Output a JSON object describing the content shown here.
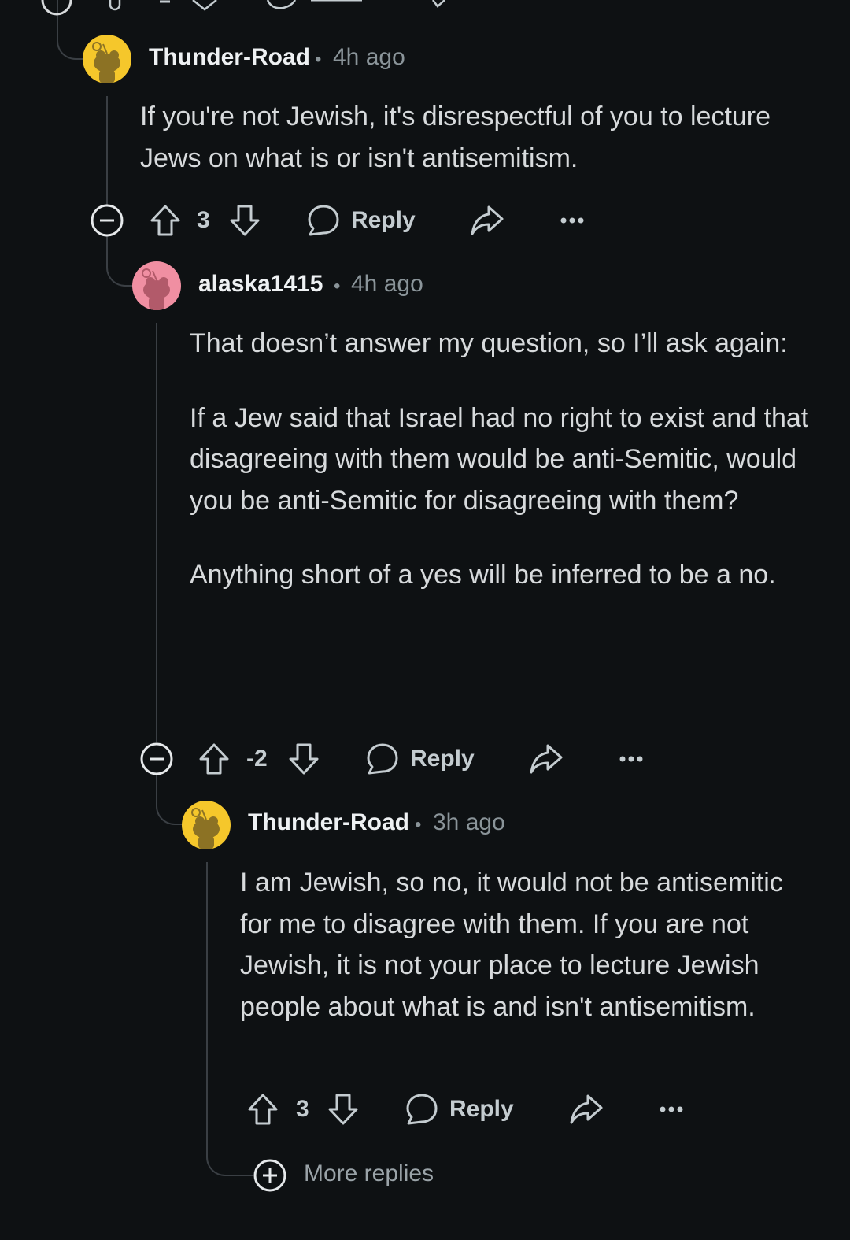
{
  "comments": [
    {
      "username": "Thunder-Road",
      "separator": "•",
      "time": "4h ago",
      "paragraphs": [
        "If you're not Jewish, it's disrespectful of you to lecture Jews on what is or isn't antisemitism."
      ],
      "votes": "3",
      "reply_label": "Reply",
      "avatar_color": "#f5c72b"
    },
    {
      "username": "alaska1415",
      "separator": "•",
      "time": "4h ago",
      "paragraphs": [
        "That doesn’t answer my question, so I’ll ask again:",
        "If a Jew said that Israel had no right to exist and that disagreeing with them would be anti-Semitic, would you be anti-Semitic for disagreeing with them?",
        "Anything short of a yes will be inferred to be a no."
      ],
      "votes": "-2",
      "reply_label": "Reply",
      "avatar_color": "#f08fa2"
    },
    {
      "username": "Thunder-Road",
      "separator": "•",
      "time": "3h ago",
      "paragraphs": [
        "I am Jewish, so no, it would not be antisemitic for me to disagree with them. If you are not Jewish, it is not your place to lecture Jewish people about what is and isn't antisemitism."
      ],
      "votes": "3",
      "reply_label": "Reply",
      "avatar_color": "#f5c72b"
    }
  ],
  "more_replies_label": "More replies",
  "icons": {
    "collapse": "collapse-icon",
    "upvote": "upvote-arrow-icon",
    "downvote": "downvote-arrow-icon",
    "reply": "speech-bubble-icon",
    "share": "share-arrow-icon",
    "more": "ellipsis-icon",
    "expand": "expand-plus-icon"
  }
}
